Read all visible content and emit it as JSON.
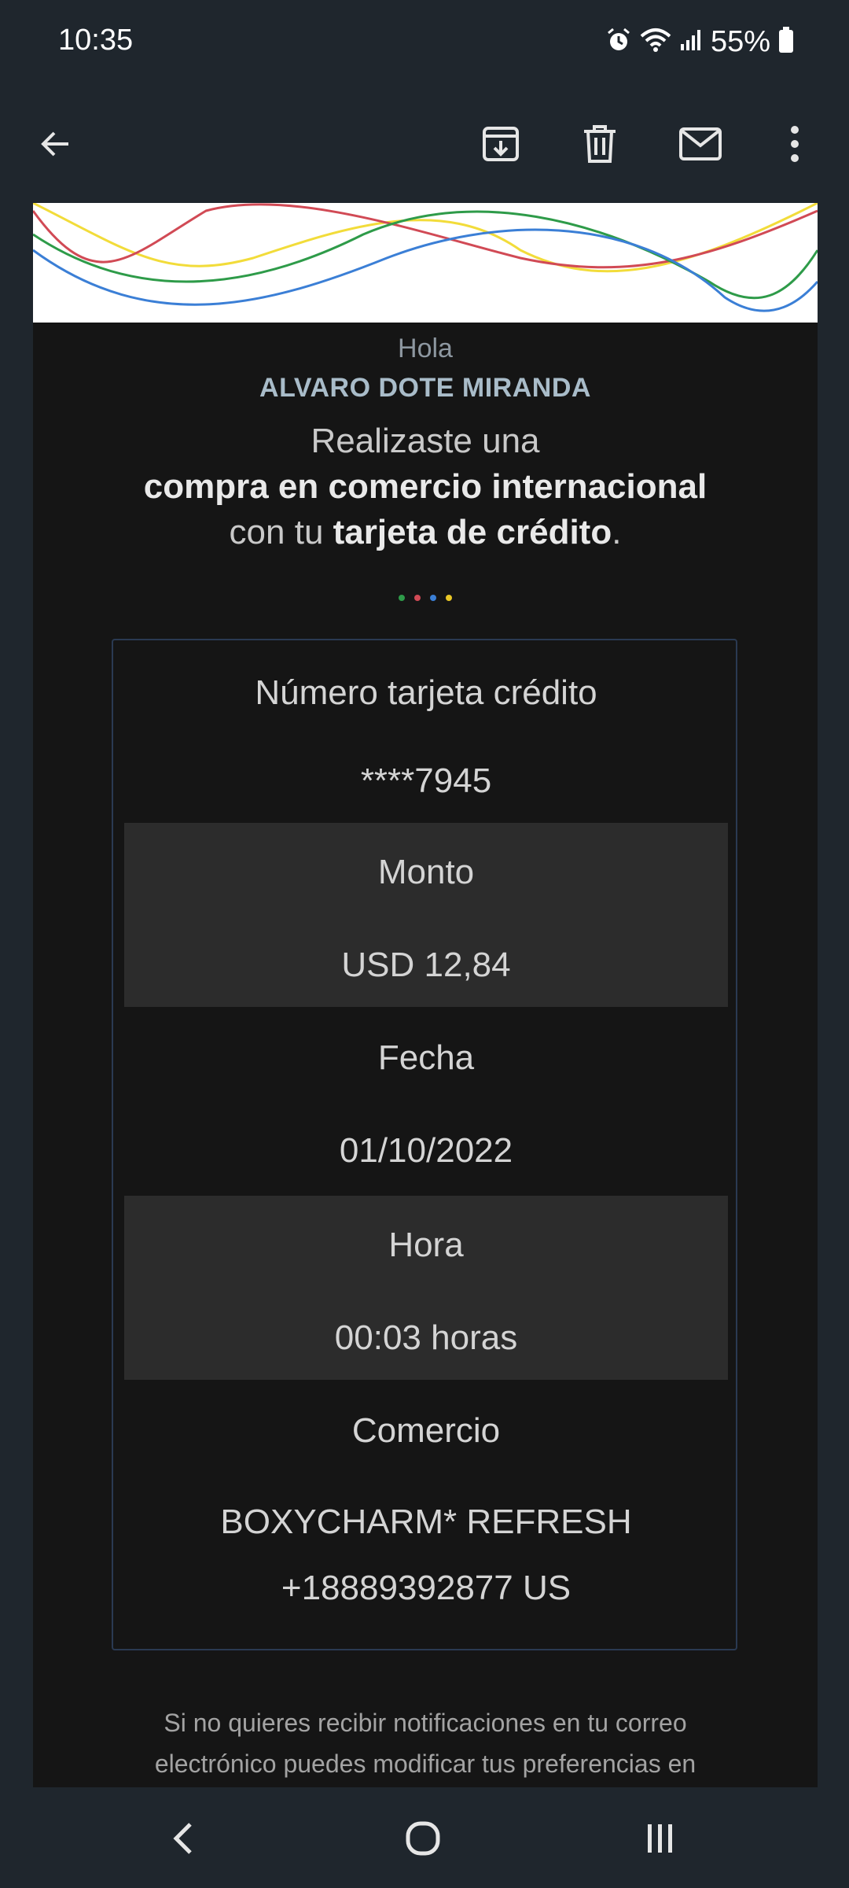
{
  "status_bar": {
    "time": "10:35",
    "battery": "55%",
    "icons": [
      "alarm-icon",
      "wifi-icon",
      "signal-icon",
      "battery-icon"
    ]
  },
  "toolbar": {
    "actions": [
      "back-arrow-icon",
      "archive-icon",
      "trash-icon",
      "mail-icon",
      "more-vert-icon"
    ]
  },
  "email": {
    "greeting": "Hola",
    "recipient_name": "ALVARO DOTE MIRANDA",
    "headline_line1": "Realizaste una",
    "headline_line2": "compra en comercio internacional",
    "headline_line3_prefix": "con tu ",
    "headline_line3_bold": "tarjeta de crédito",
    "headline_line3_suffix": ".",
    "dot_colors": [
      "#2e9b49",
      "#d14a55",
      "#3b7fd6",
      "#e9c726"
    ],
    "details": {
      "card_label": "Número tarjeta crédito",
      "card_value": "****7945",
      "amount_label": "Monto",
      "amount_value": "USD 12,84",
      "date_label": "Fecha",
      "date_value": "01/10/2022",
      "time_label": "Hora",
      "time_value": "00:03 horas",
      "merchant_label": "Comercio",
      "merchant_line1": "BOXYCHARM* REFRESH",
      "merchant_line2": "+18889392877 US"
    },
    "footer_line1": "Si no quieres recibir notificaciones en tu correo",
    "footer_line2": "electrónico puedes modificar tus preferencias en"
  },
  "nav": {
    "buttons": [
      "back-nav-icon",
      "home-nav-icon",
      "recents-nav-icon"
    ]
  },
  "colors": {
    "background": "#1f262d",
    "card": "#151515",
    "shaded_row": "#2c2c2c",
    "border": "#2a3a52",
    "wave_red": "#d14a55",
    "wave_yellow": "#f2dc3a",
    "wave_green": "#2e9b49",
    "wave_blue": "#3b7fd6"
  }
}
